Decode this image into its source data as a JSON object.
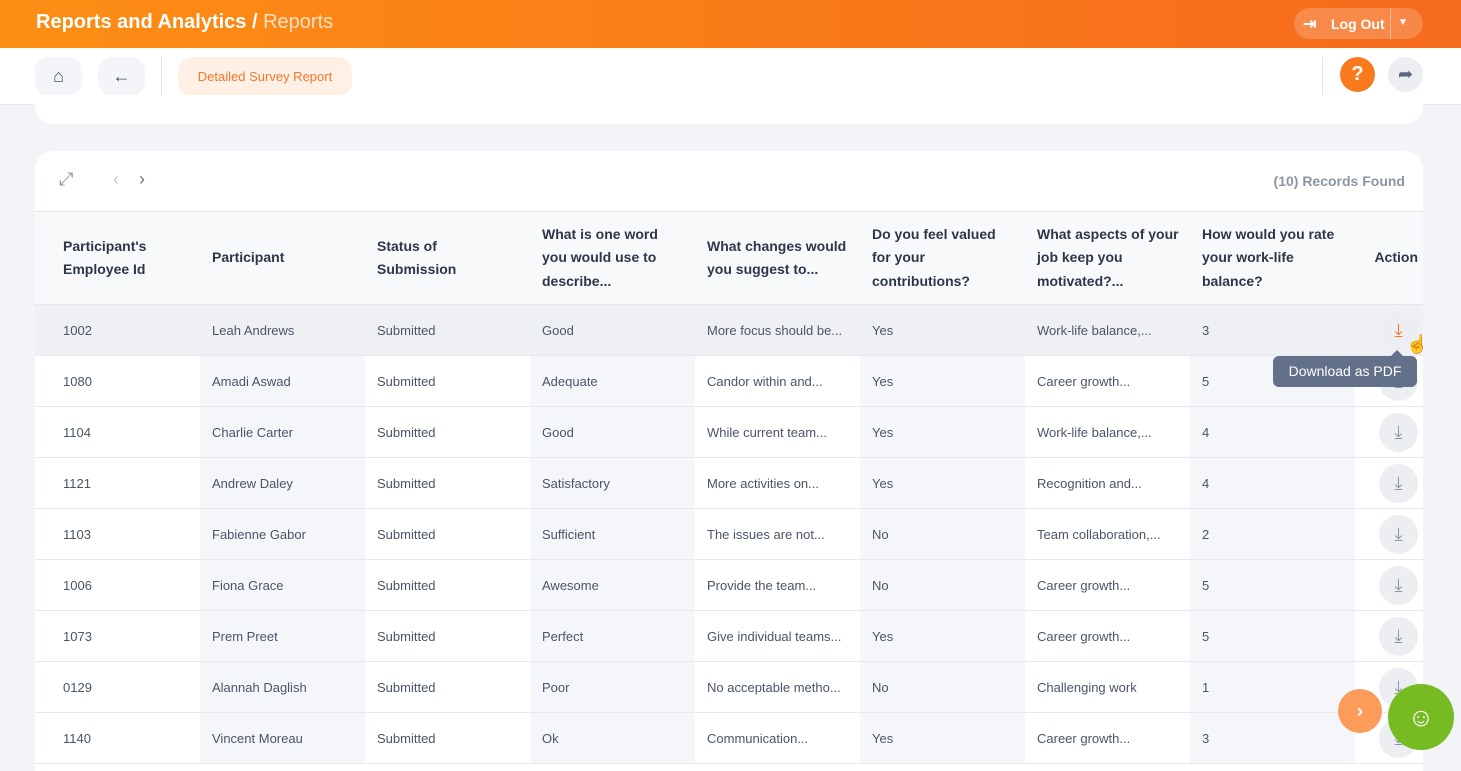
{
  "header": {
    "title": "Reports and Analytics /",
    "subtitle": "Reports",
    "logout": "Log Out"
  },
  "toolbar": {
    "tab": "Detailed Survey Report",
    "help": "?"
  },
  "table": {
    "records": "(10) Records Found",
    "columns": [
      "Participant's Employee Id",
      "Participant",
      "Status of Submission",
      "What is one word you would use to describe...",
      "What changes would you suggest to...",
      "Do you feel valued for your contributions?",
      "What aspects of your job keep you motivated?...",
      "How would you rate your work-life balance?",
      "Action"
    ],
    "rows": [
      [
        "1002",
        "Leah Andrews",
        "Submitted",
        "Good",
        "More focus should be...",
        "Yes",
        "Work-life balance,...",
        "3"
      ],
      [
        "1080",
        "Amadi Aswad",
        "Submitted",
        "Adequate",
        "Candor within and...",
        "Yes",
        "Career growth...",
        "5"
      ],
      [
        "1104",
        "Charlie Carter",
        "Submitted",
        "Good",
        "While current team...",
        "Yes",
        "Work-life balance,...",
        "4"
      ],
      [
        "1121",
        "Andrew Daley",
        "Submitted",
        "Satisfactory",
        "More activities on...",
        "Yes",
        "Recognition and...",
        "4"
      ],
      [
        "1103",
        "Fabienne Gabor",
        "Submitted",
        "Sufficient",
        "The issues are not...",
        "No",
        "Team collaboration,...",
        "2"
      ],
      [
        "1006",
        "Fiona Grace",
        "Submitted",
        "Awesome",
        "Provide the team...",
        "No",
        "Career growth...",
        "5"
      ],
      [
        "1073",
        "Prem Preet",
        "Submitted",
        "Perfect",
        "Give individual teams...",
        "Yes",
        "Career growth...",
        "5"
      ],
      [
        "0129",
        "Alannah Daglish",
        "Submitted",
        "Poor",
        "No acceptable metho...",
        "No",
        "Challenging work",
        "1"
      ],
      [
        "1140",
        "Vincent Moreau",
        "Submitted",
        "Ok",
        "Communication...",
        "Yes",
        "Career growth...",
        "3"
      ]
    ]
  },
  "tooltip": "Download as PDF"
}
